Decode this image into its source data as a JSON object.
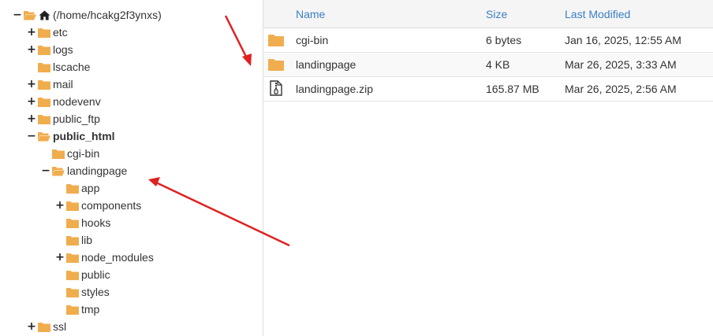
{
  "tree": {
    "root": {
      "label": "(/home/hcakg2f3ynxs)",
      "toggle": "−"
    },
    "items": [
      {
        "label": "etc",
        "toggle": "+"
      },
      {
        "label": "logs",
        "toggle": "+"
      },
      {
        "label": "lscache",
        "toggle": ""
      },
      {
        "label": "mail",
        "toggle": "+"
      },
      {
        "label": "nodevenv",
        "toggle": "+"
      },
      {
        "label": "public_ftp",
        "toggle": "+"
      },
      {
        "label": "public_html",
        "toggle": "−"
      },
      {
        "label": "cgi-bin",
        "toggle": ""
      },
      {
        "label": "landingpage",
        "toggle": "−"
      },
      {
        "label": "app",
        "toggle": ""
      },
      {
        "label": "components",
        "toggle": "+"
      },
      {
        "label": "hooks",
        "toggle": ""
      },
      {
        "label": "lib",
        "toggle": ""
      },
      {
        "label": "node_modules",
        "toggle": "+"
      },
      {
        "label": "public",
        "toggle": ""
      },
      {
        "label": "styles",
        "toggle": ""
      },
      {
        "label": "tmp",
        "toggle": ""
      },
      {
        "label": "ssl",
        "toggle": "+"
      }
    ]
  },
  "files": {
    "columns": {
      "name": "Name",
      "size": "Size",
      "modified": "Last Modified"
    },
    "rows": [
      {
        "icon": "folder-icon",
        "name": "cgi-bin",
        "size": "6 bytes",
        "modified": "Jan 16, 2025, 12:55 AM"
      },
      {
        "icon": "folder-icon",
        "name": "landingpage",
        "size": "4 KB",
        "modified": "Mar 26, 2025, 3:33 AM"
      },
      {
        "icon": "zip-file-icon",
        "name": "landingpage.zip",
        "size": "165.87 MB",
        "modified": "Mar 26, 2025, 2:56 AM"
      }
    ]
  },
  "colors": {
    "folder": "#f0ad4e",
    "link": "#3b7fc4",
    "arrow": "#e02020"
  }
}
